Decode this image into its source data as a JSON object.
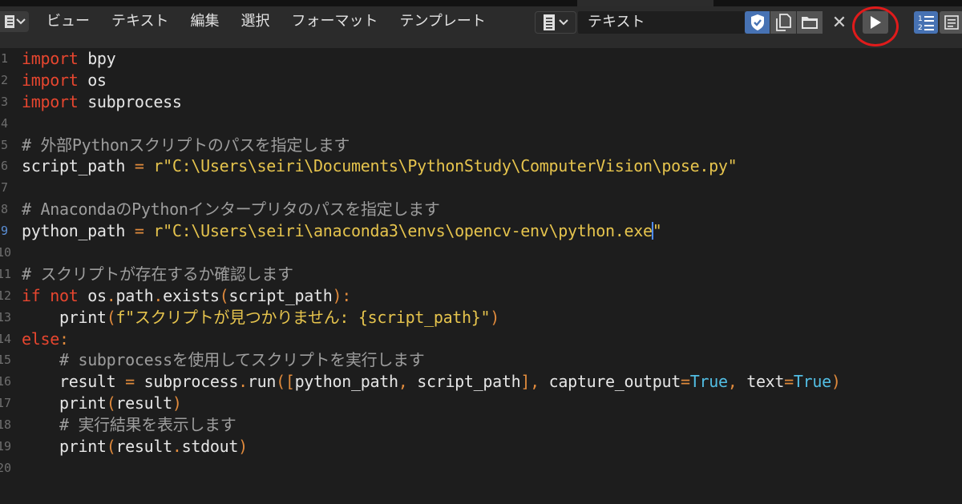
{
  "menu": [
    "ビュー",
    "テキスト",
    "編集",
    "選択",
    "フォーマット",
    "テンプレート"
  ],
  "text_name": "テキスト",
  "line_numbers": [
    "1",
    "2",
    "3",
    "4",
    "5",
    "6",
    "7",
    "8",
    "9",
    "10",
    "11",
    "12",
    "13",
    "14",
    "15",
    "16",
    "17",
    "18",
    "19",
    "20"
  ],
  "code": {
    "l1": {
      "kw": "import",
      "rest": " bpy"
    },
    "l2": {
      "kw": "import",
      "rest": " os"
    },
    "l3": {
      "kw": "import",
      "rest": " subprocess"
    },
    "l5": "# 外部Pythonスクリプトのパスを指定します",
    "l6": {
      "a": "script_path ",
      "op": "=",
      "b": " ",
      "str": "r\"C:\\Users\\seiri\\Documents\\PythonStudy\\ComputerVision\\pose.py\""
    },
    "l8": "# AnacondaのPythonインタープリタのパスを指定します",
    "l9": {
      "a": "python_path ",
      "op": "=",
      "b": " ",
      "str1": "r\"C:\\Users\\seiri\\anaconda3\\envs\\opencv-env\\python.exe",
      "str2": "\""
    },
    "l11": "# スクリプトが存在するか確認します",
    "l12": {
      "kw1": "if",
      "kw2": "not",
      "a": "os",
      "b": "path",
      "c": "exists",
      "d": "script_path"
    },
    "l13": {
      "fn": "print",
      "str": "f\"スクリプトが見つかりません: {script_path}\""
    },
    "l14": {
      "kw": "else"
    },
    "l15": "# subprocessを使用してスクリプトを実行します",
    "l16": {
      "a": "result",
      "b": "subprocess",
      "c": "run",
      "d": "python_path",
      "e": "script_path",
      "f": "capture_output",
      "g": "True",
      "h": "text",
      "i": "True"
    },
    "l17": {
      "fn": "print",
      "arg": "result"
    },
    "l18": "# 実行結果を表示します",
    "l19": {
      "fn": "print",
      "a": "result",
      "b": "stdout"
    }
  },
  "colors": {
    "accent": "#4772b3",
    "run_highlight": "#e01b1b",
    "keyword": "#e7462f",
    "string": "#e6c44d",
    "comment": "#9d9d9d",
    "builtin": "#52bde3"
  },
  "icons": [
    "text-editor-icon",
    "chevron-down-icon",
    "text-block-icon",
    "shield-check-icon",
    "new-document-icon",
    "folder-icon",
    "close-icon",
    "run-script-icon",
    "line-numbers-icon",
    "word-wrap-icon"
  ]
}
